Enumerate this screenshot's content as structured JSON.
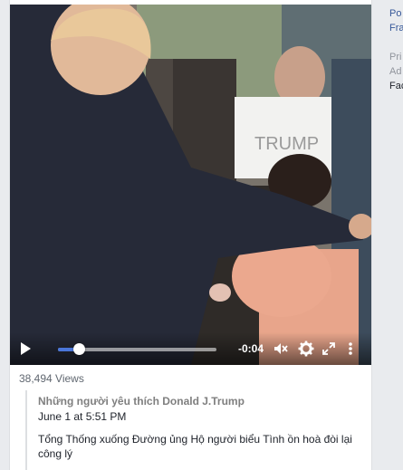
{
  "video": {
    "time_remaining": "-0:04",
    "progress": 0.13,
    "controls": {
      "play_icon": "play-icon",
      "volume_icon": "volume-icon",
      "settings_icon": "gear-icon",
      "fullscreen_icon": "fullscreen-icon",
      "more_icon": "more-icon"
    },
    "accent_color": "#4a76d9"
  },
  "post": {
    "views": "38,494 Views",
    "page_name": "Những người yêu thích Donald J.Trump",
    "timestamp": "June 1 at 5:51 PM",
    "text": "Tổng Thống xuống Đường ủng Hộ người biểu Tình ồn hoà đòi lại công lý"
  },
  "sidebar": {
    "lines": [
      "Po",
      "Fra",
      "Pri",
      "Ad",
      "Fac"
    ]
  }
}
